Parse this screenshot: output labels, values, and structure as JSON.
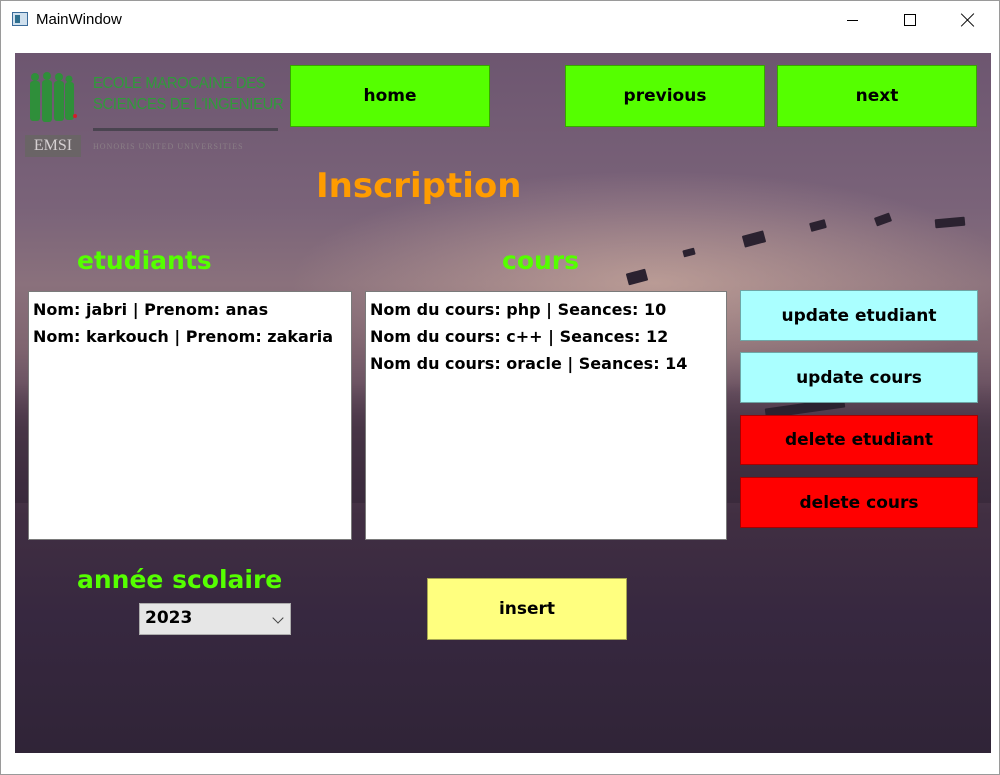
{
  "window": {
    "title": "MainWindow",
    "icon": "app-window-icon"
  },
  "logo": {
    "line1": "ECOLE MAROCAINE DES",
    "line2": "SCIENCES DE L'INGENIEUR",
    "badge": "EMSI",
    "tagline": "HONORIS UNITED UNIVERSITIES"
  },
  "nav": {
    "home": "home",
    "previous": "previous",
    "next": "next"
  },
  "page": {
    "title": "Inscription"
  },
  "etudiants": {
    "label": "etudiants",
    "items": [
      "Nom: jabri | Prenom: anas",
      "Nom: karkouch | Prenom: zakaria"
    ]
  },
  "cours": {
    "label": "cours",
    "items": [
      "Nom du cours: php | Seances: 10",
      "Nom du cours: c++ | Seances: 12",
      "Nom du cours: oracle | Seances: 14"
    ]
  },
  "actions": {
    "update_etudiant": "update etudiant",
    "update_cours": "update cours",
    "delete_etudiant": "delete etudiant",
    "delete_cours": "delete cours",
    "insert": "insert"
  },
  "annee": {
    "label": "année scolaire",
    "selected": "2023"
  },
  "colors": {
    "nav_green": "#55ff00",
    "title_orange": "#ff9c00",
    "update_cyan": "#aaffff",
    "delete_red": "#ff0000",
    "insert_yellow": "#ffff7f"
  }
}
